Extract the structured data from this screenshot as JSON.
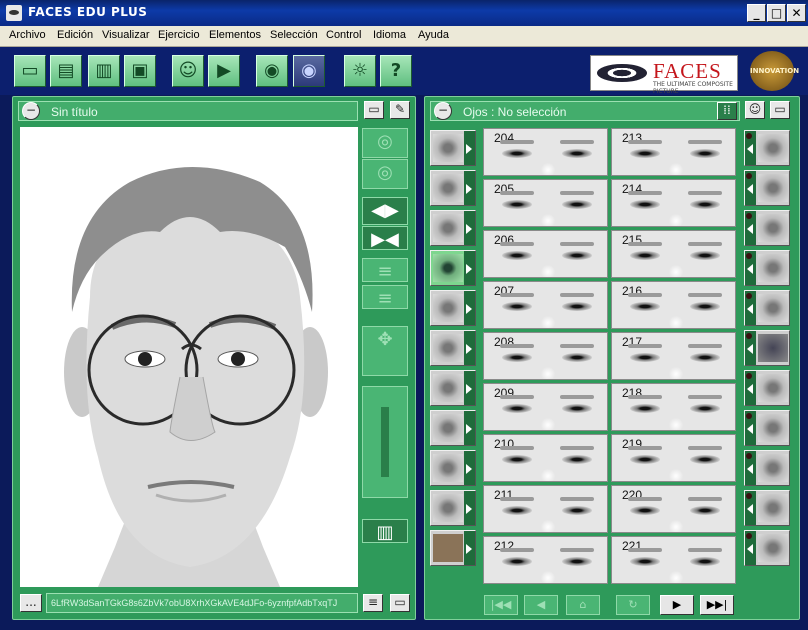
{
  "window": {
    "title": "FACES EDU PLUS",
    "controls": [
      "_",
      "□",
      "✕"
    ]
  },
  "menu": [
    "Archivo",
    "Edición",
    "Visualizar",
    "Ejercicio",
    "Elementos",
    "Selección",
    "Control",
    "Idioma",
    "Ayuda"
  ],
  "toolbar": {
    "buttons": [
      "new-document",
      "open-file",
      "open-folder",
      "save",
      "face-profile",
      "export-face",
      "view-eye",
      "view-eye-active",
      "hint-light",
      "help"
    ],
    "labels": {
      "help": "?"
    }
  },
  "brand": {
    "name": "FACES",
    "tagline": "THE ULTIMATE COMPOSITE PICTURE",
    "badge": "INNOVATION"
  },
  "left_panel": {
    "title": "Sin título",
    "code": "6LfRW3dSanTGkG8s6ZbVk7obU8XrhXGkAVE4dJFo-6yznfpfAdbTxqTJ",
    "code_button": "..."
  },
  "right_panel": {
    "title": "Ojos : No selección",
    "selected_category": "eyes",
    "left_categories": [
      "hair-1",
      "hair-2",
      "eyebrows",
      "eyes",
      "nose",
      "lips",
      "chin",
      "mustache",
      "beard",
      "goatee",
      "skin-texture"
    ],
    "right_categories": [
      "mouth-1",
      "mouth-2",
      "mouth-3",
      "mouth-4",
      "chin-shape",
      "hat",
      "glasses",
      "mole",
      "scar",
      "pipe",
      "other"
    ],
    "thumbnails_col1": [
      "204",
      "205",
      "206",
      "207",
      "208",
      "209",
      "210",
      "211",
      "212"
    ],
    "thumbnails_col2": [
      "213",
      "214",
      "215",
      "216",
      "217",
      "218",
      "219",
      "220",
      "221"
    ]
  },
  "nav": [
    "first",
    "prev",
    "up",
    "refresh",
    "play",
    "last"
  ]
}
